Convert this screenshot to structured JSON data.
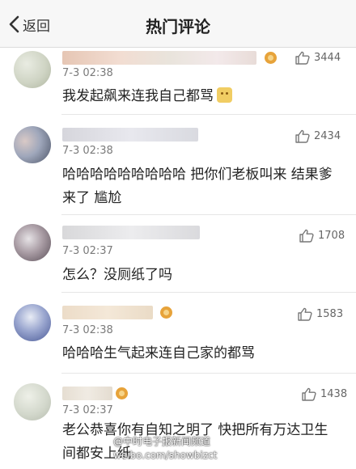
{
  "header": {
    "back_label": "返回",
    "title": "热门评论"
  },
  "comments": [
    {
      "time": "7-3 02:38",
      "likes": "3444",
      "text": "我发起飙来连我自己都骂"
    },
    {
      "time": "7-3 02:38",
      "likes": "2434",
      "text": "哈哈哈哈哈哈哈哈哈 把你们老板叫来 结果爹来了 尴尬"
    },
    {
      "time": "7-3 02:37",
      "likes": "1708",
      "text": "怎么？没厕纸了吗"
    },
    {
      "time": "7-3 02:38",
      "likes": "1583",
      "text": "哈哈哈生气起来连自己家的都骂"
    },
    {
      "time": "7-3 02:37",
      "likes": "1438",
      "text": "老公恭喜你有自知之明了 快把所有万达卫生间都安上纸"
    }
  ],
  "watermark": {
    "line1": "@中时电子报新闻频道",
    "line2": "weibo.com/showbizct"
  }
}
